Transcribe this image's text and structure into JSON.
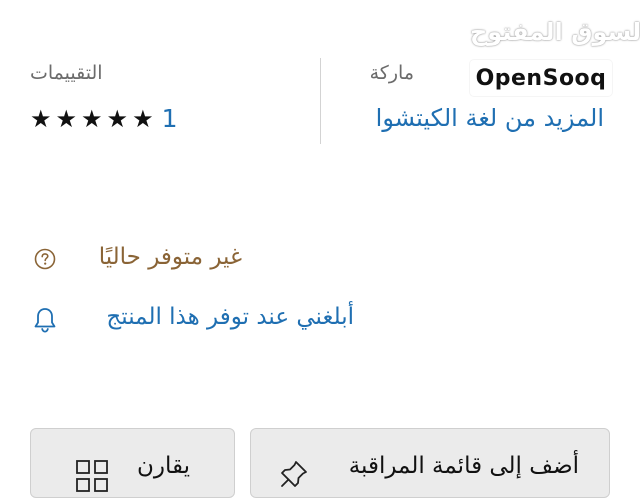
{
  "brand": {
    "label": "ماركة",
    "link": "المزيد من لغة الكيتشوا"
  },
  "ratings": {
    "label": "التقييمات",
    "stars": [
      "★",
      "★",
      "★",
      "★",
      "★"
    ],
    "count": "1",
    "rating_value": 5
  },
  "watermark": {
    "arabic": "السوق المفتوح",
    "latin": "OpenSooq"
  },
  "availability": {
    "status": "غير متوفر حاليًا",
    "notify": "أبلغني عند توفر هذا المنتج"
  },
  "actions": {
    "watchlist": "أضف إلى قائمة المراقبة",
    "compare": "يقارن"
  },
  "colors": {
    "link": "#1f6fb2",
    "availability": "#8a6436",
    "button_bg": "#ebebeb"
  }
}
